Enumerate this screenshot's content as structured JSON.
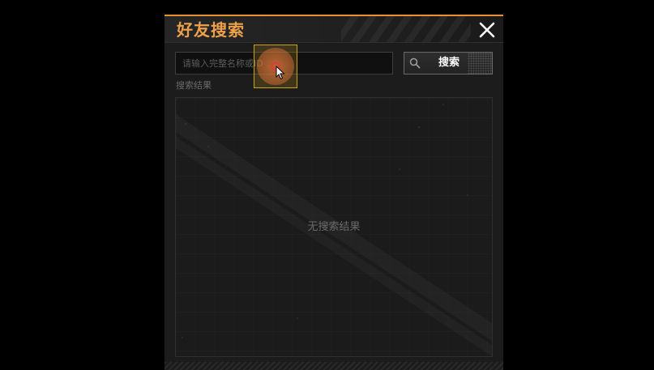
{
  "dialog": {
    "title": "好友搜索",
    "accent_color": "#e8912d",
    "close_icon": "close-icon"
  },
  "search": {
    "placeholder": "请输入完整名称或ID",
    "value": "",
    "button_label": "搜索",
    "button_icon": "search-icon"
  },
  "results": {
    "label": "搜索结果",
    "empty_text": "无搜索结果"
  }
}
